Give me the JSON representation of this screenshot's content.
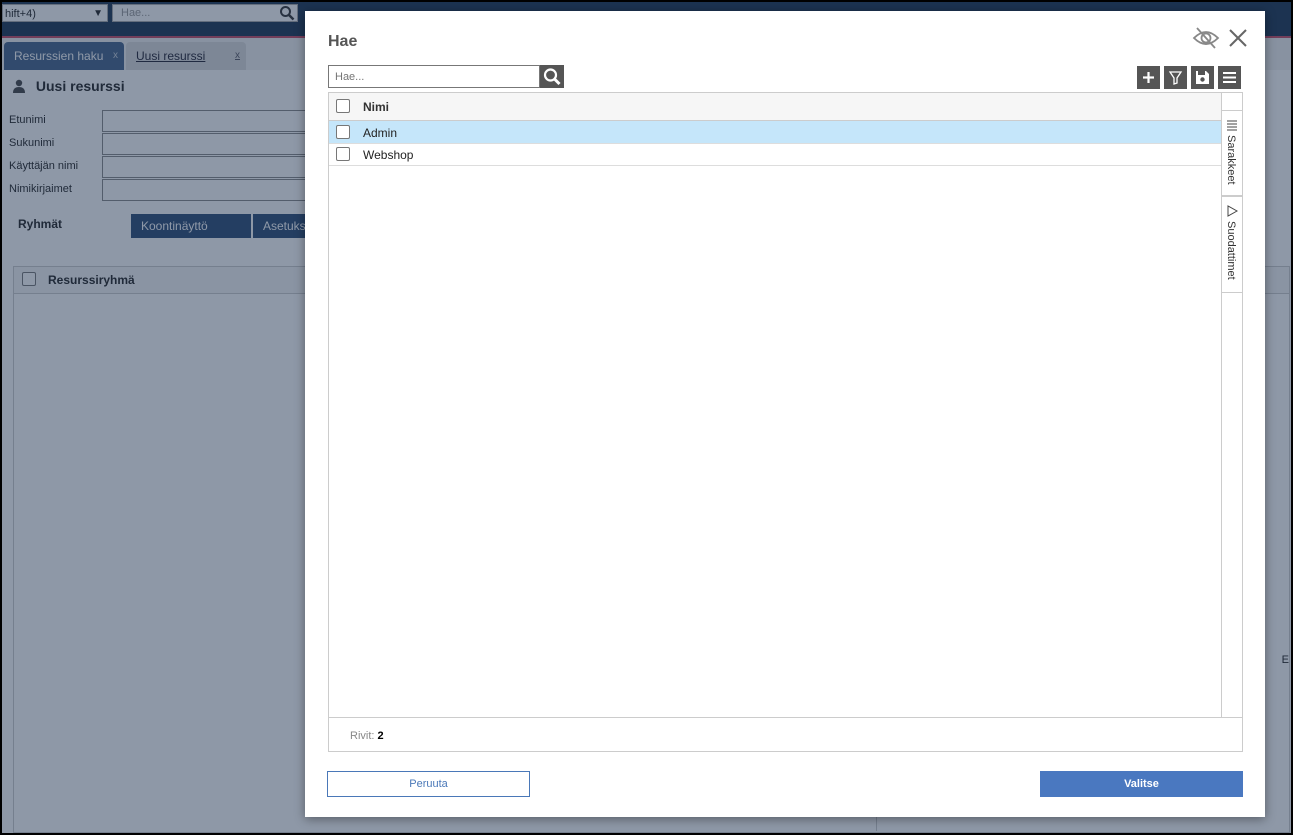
{
  "topbar": {
    "select_value": "hift+4)",
    "search_placeholder": "Hae..."
  },
  "tabs": [
    {
      "label": "Resurssien haku",
      "close": "x"
    },
    {
      "label": "Uusi resurssi",
      "close": "x"
    }
  ],
  "page": {
    "title": "Uusi resurssi",
    "fields": [
      "Etunimi",
      "Sukunimi",
      "Käyttäjän nimi",
      "Nimikirjaimet"
    ],
    "subtabs": [
      "Ryhmät",
      "Koontinäyttö",
      "Asetuks"
    ],
    "grid_header": "Resurssiryhmä",
    "side_letter": "E"
  },
  "modal": {
    "title": "Hae",
    "search_placeholder": "Hae...",
    "grid": {
      "column": "Nimi",
      "rows": [
        "Admin",
        "Webshop"
      ],
      "side_panels": [
        "Sarakkeet",
        "Suodattimet"
      ],
      "footer_label": "Rivit:",
      "footer_count": "2"
    },
    "cancel_label": "Peruuta",
    "ok_label": "Valitse"
  },
  "colors": {
    "accent": "#4a78c0",
    "selected_row": "#c5e6fa",
    "topbar": "#1b3453"
  }
}
